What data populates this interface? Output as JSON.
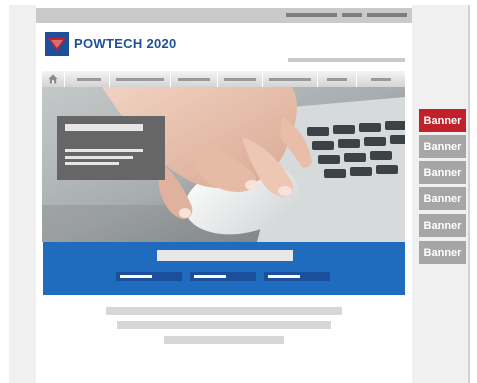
{
  "header": {
    "brand": "POWTECH 2020"
  },
  "banners": [
    "Banner",
    "Banner",
    "Banner",
    "Banner",
    "Banner",
    "Banner"
  ],
  "colors": {
    "brand_blue": "#1f4f9a",
    "promo_blue": "#1f6cbf",
    "banner_active": "#c1212b",
    "banner_idle": "#a6a6a6"
  },
  "icons": {
    "home": "home-icon",
    "logo": "powtech-logo-icon"
  },
  "hero": {
    "image": "photo of a hand holding a white computer mouse beside a laptop keyboard"
  }
}
